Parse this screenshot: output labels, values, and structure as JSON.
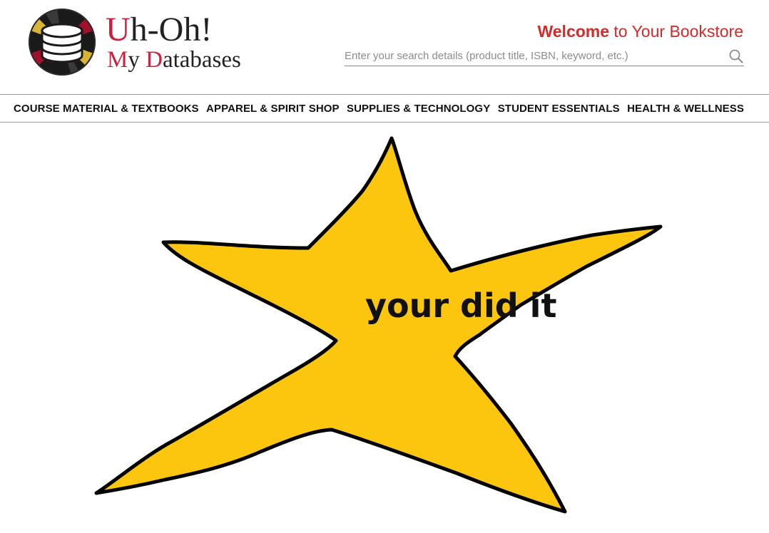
{
  "brand": {
    "line1_cap": "U",
    "line1_rest": "h-Oh!",
    "line2_cap1": "M",
    "line2_mid": "y ",
    "line2_cap2": "D",
    "line2_rest": "atabases"
  },
  "header": {
    "welcome_bold": "Welcome",
    "welcome_rest": " to Your Bookstore"
  },
  "search": {
    "placeholder": "Enter your search details (product title, ISBN, keyword, etc.)",
    "value": ""
  },
  "nav": {
    "items": [
      {
        "label": "COURSE MATERIAL & TEXTBOOKS"
      },
      {
        "label": "APPAREL & SPIRIT SHOP"
      },
      {
        "label": "SUPPLIES & TECHNOLOGY"
      },
      {
        "label": "STUDENT ESSENTIALS"
      },
      {
        "label": "HEALTH & WELLNESS"
      }
    ]
  },
  "main": {
    "star_text": "your did it"
  },
  "colors": {
    "brand_red": "#cf1f3c",
    "welcome_red": "#d42a2a",
    "star_fill": "#fcc60e",
    "star_outline": "#000000"
  },
  "icons": {
    "logo": "database-logo-icon",
    "search": "search-icon"
  }
}
